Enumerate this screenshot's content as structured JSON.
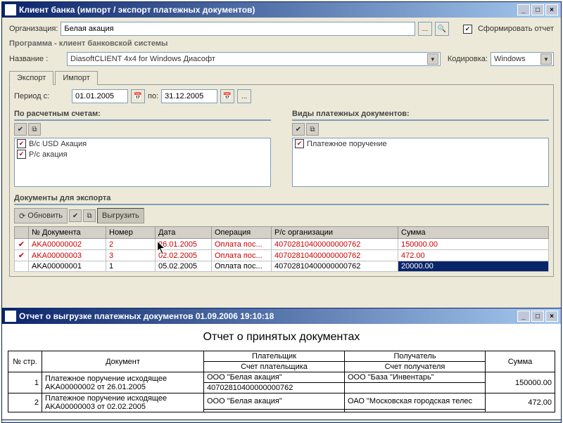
{
  "win1": {
    "title": "Клиент банка (импорт / экспорт платежных документов)",
    "org_label": "Организация:",
    "org_value": "Белая акация",
    "form_report_label": "Сформировать отчет",
    "program_section": "Программа - клиент банковской системы",
    "name_label": "Название :",
    "name_value": "DiasoftCLIENT 4x4 for Windows Диасофт",
    "encoding_label": "Кодировка:",
    "encoding_value": "Windows",
    "tabs": {
      "export": "Экспорт",
      "import": "Импорт"
    },
    "period_label": "Период с:",
    "period_from": "01.01.2005",
    "period_to_label": "по:",
    "period_to": "31.12.2005",
    "accounts_group": "По расчетным счетам:",
    "accounts": [
      {
        "checked": true,
        "label": "В/с USD Акация"
      },
      {
        "checked": true,
        "label": "Р/с акация"
      }
    ],
    "doctypes_group": "Виды платежных документов:",
    "doctypes": [
      {
        "checked": true,
        "label": "Платежное поручение"
      }
    ],
    "docs_group": "Документы для экспорта",
    "btn_refresh": "Обновить",
    "btn_export": "Выгрузить",
    "grid_headers": {
      "mark": "",
      "docnum": "№ Документа",
      "num": "Номер",
      "date": "Дата",
      "op": "Операция",
      "acc": "Р/с организации",
      "sum": "Сумма"
    },
    "grid_rows": [
      {
        "mark": "✔",
        "docnum": "AKA00000002",
        "num": "2",
        "date": "26.01.2005",
        "op": "Оплата пос...",
        "acc": "40702810400000000762",
        "sum": "150000.00"
      },
      {
        "mark": "✔",
        "docnum": "AKA00000003",
        "num": "3",
        "date": "02.02.2005",
        "op": "Оплата пос...",
        "acc": "40702810400000000762",
        "sum": "472.00"
      },
      {
        "mark": "",
        "docnum": "AKA00000001",
        "num": "1",
        "date": "05.02.2005",
        "op": "Оплата пос...",
        "acc": "40702810400000000762",
        "sum": "20000.00",
        "sum_selected": true,
        "black": true
      }
    ]
  },
  "win2": {
    "title": "Отчет о выгрузке платежных документов 01.09.2006 19:10:18",
    "report_title": "Отчет о принятых документах",
    "headers": {
      "page": "№ стр.",
      "doc": "Документ",
      "payer": "Плательщик",
      "payer_acc": "Счет плательщика",
      "payee": "Получатель",
      "payee_acc": "Счет получателя",
      "sum": "Сумма"
    },
    "rows": [
      {
        "page": "1",
        "doc": "Платежное поручение исходящее AKA00000002 от 26.01.2005",
        "payer": "ООО \"Белая акация\"",
        "payer_acc": "40702810400000000762",
        "payee": "ООО \"База \"Инвентарь\"",
        "sum": "150000.00"
      },
      {
        "page": "2",
        "doc": "Платежное поручение исходящее AKA00000003 от 02.02.2005",
        "payer": "ООО \"Белая акация\"",
        "payer_acc": "",
        "payee": "ОАО \"Московская городская телес",
        "sum": "472.00"
      }
    ]
  }
}
